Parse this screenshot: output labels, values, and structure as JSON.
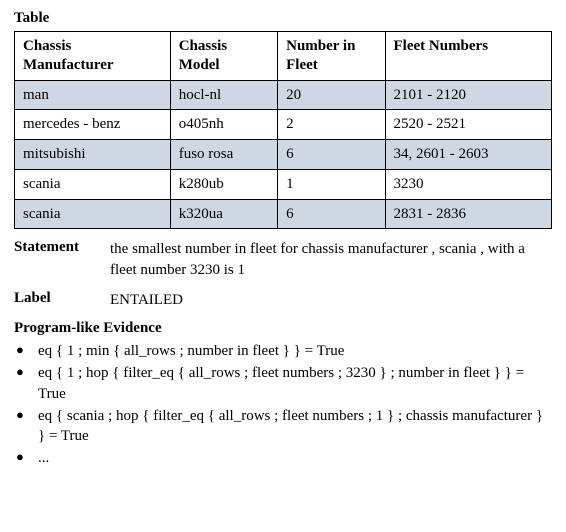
{
  "table": {
    "heading": "Table",
    "headers": [
      "Chassis Manufacturer",
      "Chassis Model",
      "Number in Fleet",
      "Fleet Numbers"
    ],
    "rows": [
      {
        "shaded": true,
        "cells": [
          "man",
          "hocl-nl",
          "20",
          "2101 - 2120"
        ]
      },
      {
        "shaded": false,
        "cells": [
          "mercedes - benz",
          "o405nh",
          "2",
          "2520 - 2521"
        ]
      },
      {
        "shaded": true,
        "cells": [
          "mitsubishi",
          "fuso rosa",
          "6",
          "34, 2601 - 2603"
        ]
      },
      {
        "shaded": false,
        "cells": [
          "scania",
          "k280ub",
          "1",
          "3230"
        ]
      },
      {
        "shaded": true,
        "cells": [
          "scania",
          "k320ua",
          "6",
          "2831 - 2836"
        ]
      }
    ]
  },
  "statement": {
    "key": "Statement",
    "text": "the smallest number in fleet for chassis manufacturer , scania , with a fleet number 3230 is 1"
  },
  "label": {
    "key": "Label",
    "text": "ENTAILED"
  },
  "evidence": {
    "heading": "Program-like Evidence",
    "items": [
      "eq { 1 ; min { all_rows ; number in fleet } }  = True",
      "eq { 1 ; hop { filter_eq { all_rows ; fleet numbers ; 3230 } ; number in fleet } } = True",
      "eq { scania ; hop { filter_eq { all_rows ; fleet numbers ; 1 } ; chassis manufacturer } } = True",
      "..."
    ]
  }
}
